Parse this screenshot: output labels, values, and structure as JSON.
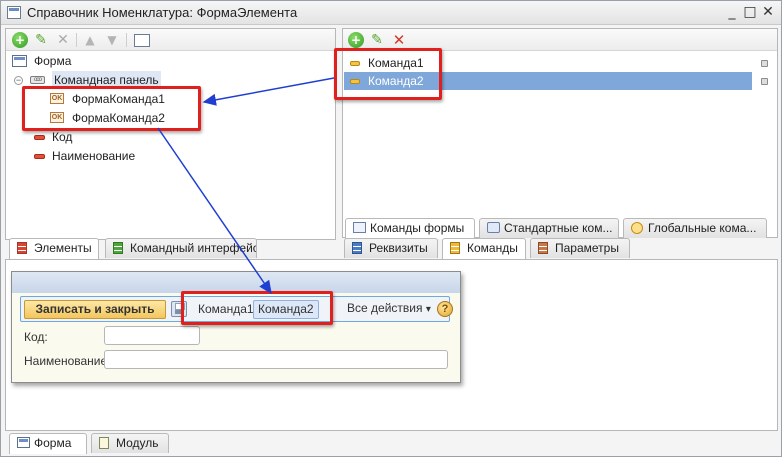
{
  "window": {
    "title": "Справочник Номенклатура: ФормаЭлемента",
    "controls": {
      "minimize": "_",
      "maximize": "□",
      "close": "✕"
    }
  },
  "left_panel": {
    "tree": {
      "root": "Форма",
      "command_panel": "Командная панель",
      "commands": [
        "ФормаКоманда1",
        "ФормаКоманда2"
      ],
      "fields": [
        "Код",
        "Наименование"
      ]
    },
    "tabs": [
      "Элементы",
      "Командный интерфейс"
    ]
  },
  "right_panel": {
    "commands": [
      "Команда1",
      "Команда2"
    ],
    "selected_index": 1,
    "inner_tabs": [
      "Команды формы",
      "Стандартные ком...",
      "Глобальные кома..."
    ],
    "tabs": [
      "Реквизиты",
      "Команды",
      "Параметры"
    ]
  },
  "preview": {
    "save_close": "Записать и закрыть",
    "buttons": [
      "Команда1",
      "Команда2"
    ],
    "all_actions": "Все действия",
    "all_actions_arrow": "▾",
    "help": "?",
    "fields": [
      {
        "label": "Код:",
        "value": ""
      },
      {
        "label": "Наименование:",
        "value": ""
      }
    ]
  },
  "bottom_tabs": [
    "Форма",
    "Модуль"
  ],
  "icons": {
    "add": "add-icon",
    "edit": "pencil-icon",
    "delete": "delete-icon",
    "move_up": "arrow-up-icon",
    "move_down": "arrow-down-icon",
    "properties": "properties-icon"
  },
  "colors": {
    "highlight": "#e0201c",
    "selection": "#7fa7d9",
    "arrow": "#1f3fd1",
    "save_button": "#f3c65d"
  }
}
